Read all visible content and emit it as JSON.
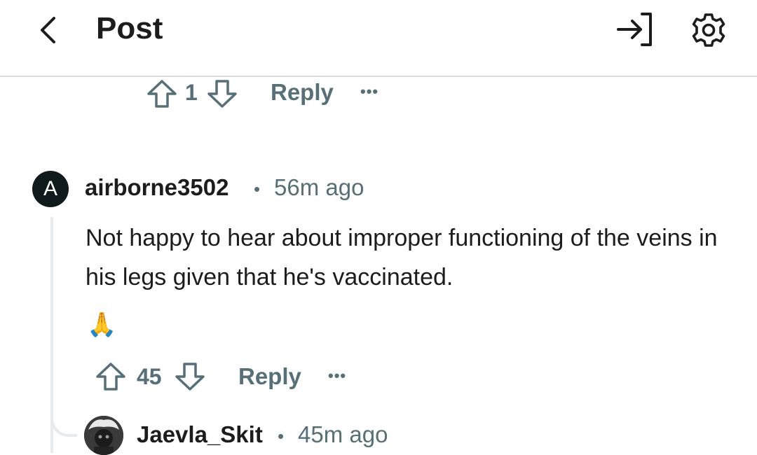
{
  "header": {
    "title": "Post",
    "back_icon": "chevron-left-icon",
    "login_icon": "login-icon",
    "settings_icon": "gear-icon"
  },
  "prev_comment_actions": {
    "vote_count": "1",
    "reply_label": "Reply",
    "more_label": "•••"
  },
  "comment": {
    "avatar_letter": "A",
    "username": "airborne3502",
    "separator": "•",
    "time": "56m ago",
    "body": "Not happy to hear about improper functioning of the veins in his legs given that he's vaccinated.",
    "emoji": "🙏",
    "vote_count": "45",
    "reply_label": "Reply",
    "more_label": "•••"
  },
  "reply": {
    "username": "Jaevla_Skit",
    "separator": "•",
    "time": "45m ago"
  },
  "colors": {
    "text": "#1c1c1c",
    "meta_gray": "#576f76",
    "divider": "#d9dde3",
    "thread_line": "#e5ebee"
  }
}
